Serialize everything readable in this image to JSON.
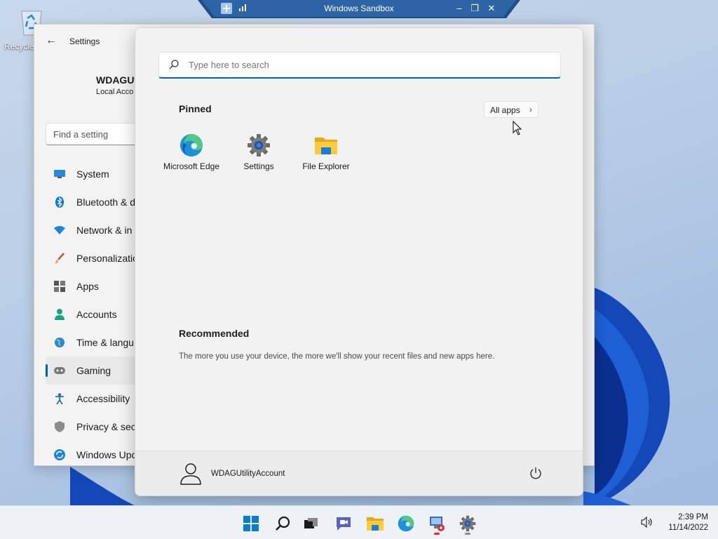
{
  "desktop": {
    "recycle_bin_label": "Recycle"
  },
  "sandbox": {
    "title": "Windows Sandbox",
    "minimize": "–",
    "restore": "❐",
    "close": "✕"
  },
  "settings": {
    "title": "Settings",
    "back": "←",
    "profile_name": "WDAGUt",
    "profile_sub": "Local Acco",
    "find_placeholder": "Find a setting",
    "nav": [
      {
        "label": "System",
        "icon": "system-icon"
      },
      {
        "label": "Bluetooth & d",
        "icon": "bluetooth-icon"
      },
      {
        "label": "Network & in",
        "icon": "network-icon"
      },
      {
        "label": "Personalizatio",
        "icon": "brush-icon"
      },
      {
        "label": "Apps",
        "icon": "apps-icon"
      },
      {
        "label": "Accounts",
        "icon": "accounts-icon"
      },
      {
        "label": "Time & langu",
        "icon": "globe-icon"
      },
      {
        "label": "Gaming",
        "icon": "gamepad-icon",
        "active": true
      },
      {
        "label": "Accessibility",
        "icon": "accessibility-icon"
      },
      {
        "label": "Privacy & secu",
        "icon": "shield-icon"
      },
      {
        "label": "Windows Upd",
        "icon": "update-icon"
      }
    ]
  },
  "start_menu": {
    "search_placeholder": "Type here to search",
    "pinned_title": "Pinned",
    "all_apps_label": "All apps",
    "all_apps_chevron": "›",
    "pinned_apps": [
      {
        "label": "Microsoft Edge",
        "icon": "edge-icon"
      },
      {
        "label": "Settings",
        "icon": "settings-gear-icon"
      },
      {
        "label": "File Explorer",
        "icon": "folder-icon"
      }
    ],
    "recommended_title": "Recommended",
    "recommended_text": "The more you use your device, the more we'll show your recent files and new apps here.",
    "user_name": "WDAGUtilityAccount"
  },
  "taskbar": {
    "items": [
      "start-icon",
      "search-icon",
      "task-view-icon",
      "chat-icon",
      "file-explorer-icon",
      "edge-icon",
      "remote-app-icon",
      "settings-icon"
    ],
    "time": "2:39 PM",
    "date": "11/14/2022"
  },
  "colors": {
    "accent": "#005fb8",
    "taskbar": "#eef2f7",
    "start_bg": "#f2f2f2"
  }
}
